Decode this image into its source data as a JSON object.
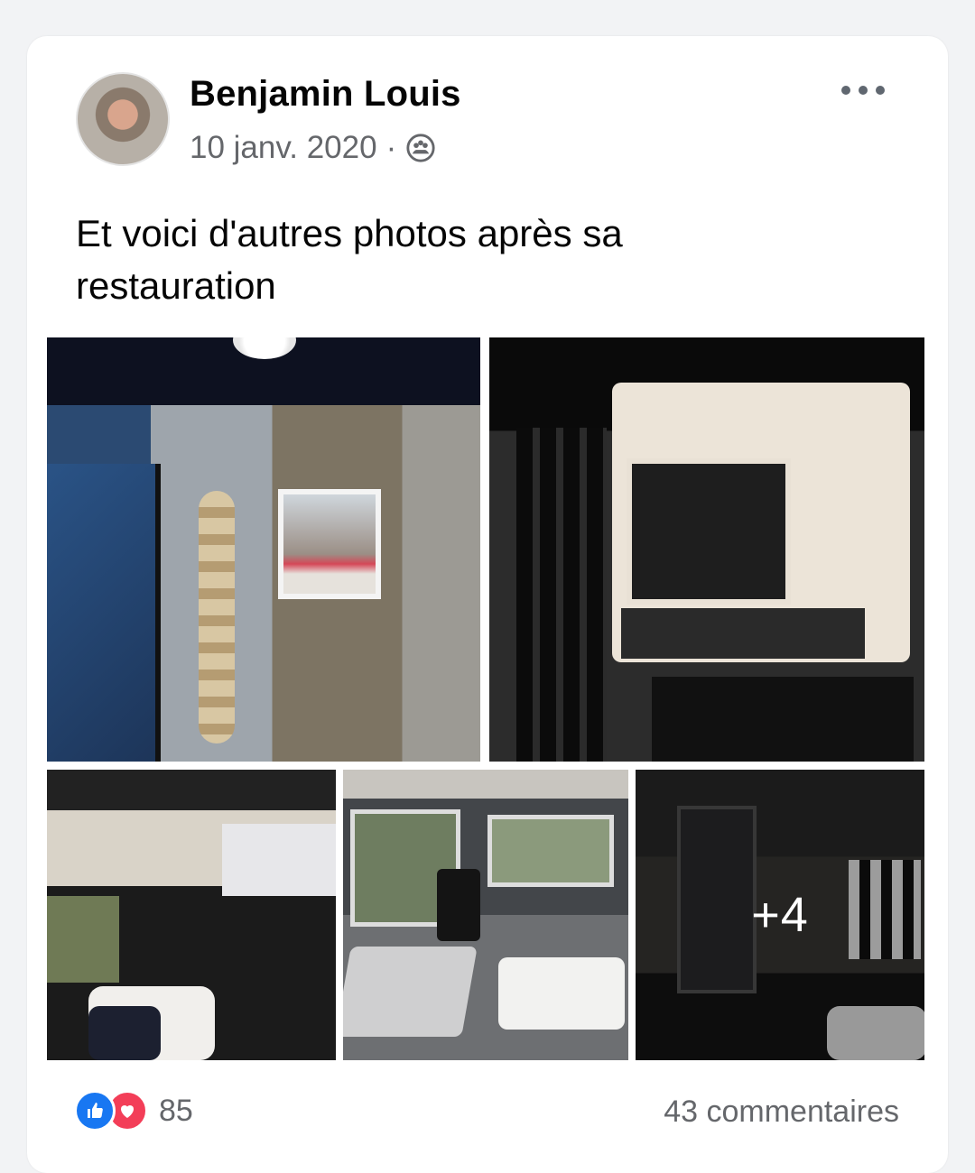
{
  "post": {
    "author": "Benjamin Louis",
    "date": "10 janv. 2020",
    "separator": "·",
    "audience_icon": "group-icon",
    "text": "Et voici d'autres photos après sa\nrestauration"
  },
  "photos": {
    "extra_count_label": "+4"
  },
  "footer": {
    "reaction_count": "85",
    "comments_label": "43 commentaires"
  },
  "colors": {
    "like_blue": "#1877f2",
    "love_red": "#f33e58",
    "secondary_text": "#65676b"
  }
}
